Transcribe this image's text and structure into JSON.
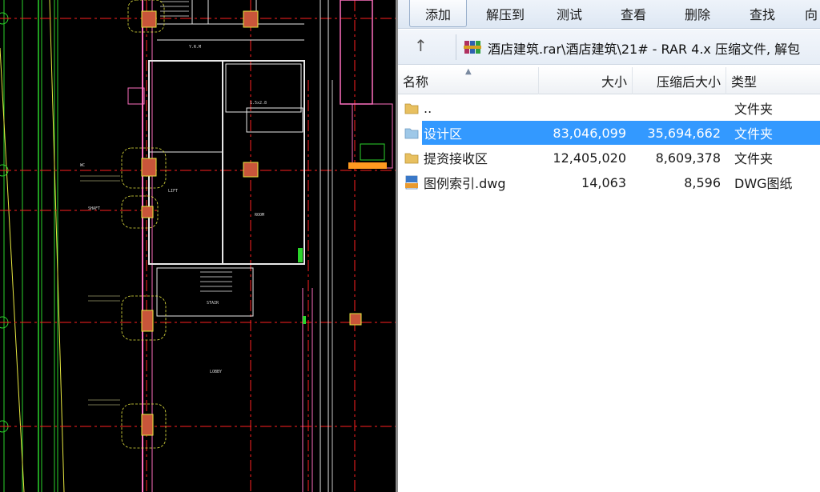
{
  "toolbar": {
    "buttons": [
      {
        "label": "添加",
        "active": true
      },
      {
        "label": "解压到",
        "active": false
      },
      {
        "label": "测试",
        "active": false
      },
      {
        "label": "查看",
        "active": false
      },
      {
        "label": "删除",
        "active": false
      },
      {
        "label": "查找",
        "active": false
      },
      {
        "label": "向",
        "active": false
      }
    ]
  },
  "address": {
    "path": "酒店建筑.rar\\酒店建筑\\21# - RAR 4.x 压缩文件, 解包"
  },
  "columns": {
    "name": "名称",
    "size": "大小",
    "packed": "压缩后大小",
    "type": "类型"
  },
  "files": [
    {
      "name": "..",
      "size": "",
      "packed": "",
      "type": "文件夹",
      "icon": "folder-icon",
      "selected": false
    },
    {
      "name": "设计区",
      "size": "83,046,099",
      "packed": "35,694,662",
      "type": "文件夹",
      "icon": "folder-icon",
      "selected": true
    },
    {
      "name": "提资接收区",
      "size": "12,405,020",
      "packed": "8,609,378",
      "type": "文件夹",
      "icon": "folder-icon",
      "selected": false
    },
    {
      "name": "图例索引.dwg",
      "size": "14,063",
      "packed": "8,596",
      "type": "DWG图纸",
      "icon": "dwg-file-icon",
      "selected": false
    }
  ],
  "cad": {
    "room_labels": [
      "Y.R.M",
      "1.5x2.8",
      "STAIR",
      "LOBBY",
      "LIFT",
      "ROOM",
      "WC",
      "SHAFT"
    ]
  },
  "colors": {
    "selection": "#3399ff",
    "cad_background": "#000000",
    "axis_line": "#ff2020",
    "column": "#c8553a"
  }
}
